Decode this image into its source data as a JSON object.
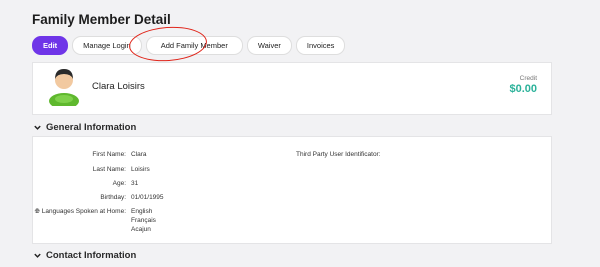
{
  "page": {
    "title": "Family Member Detail"
  },
  "tabs": [
    {
      "label": "Edit"
    },
    {
      "label": "Manage Login"
    },
    {
      "label": "Add Family Member"
    },
    {
      "label": "Waiver"
    },
    {
      "label": "Invoices"
    }
  ],
  "member": {
    "name": "Clara Loisirs",
    "credit_label": "Credit",
    "credit_value": "$0.00"
  },
  "general": {
    "title": "General Information",
    "first_name_label": "First Name:",
    "first_name": "Clara",
    "last_name_label": "Last Name:",
    "last_name": "Loisirs",
    "age_label": "Age:",
    "age": "31",
    "birthday_label": "Birthday:",
    "birthday": "01/01/1995",
    "languages_label": "Languages Spoken at Home:",
    "languages": [
      "English",
      "Français",
      "Acajun"
    ],
    "third_party_label": "Third Party User Identificator:"
  },
  "contact": {
    "title": "Contact Information"
  },
  "colors": {
    "accent": "#6f35e8",
    "credit": "#2bb29a",
    "annotation": "#e0261b"
  },
  "icons": {
    "section_toggle": "chevron-down-icon",
    "language": "globe-icon",
    "avatar": "user-avatar-icon"
  }
}
